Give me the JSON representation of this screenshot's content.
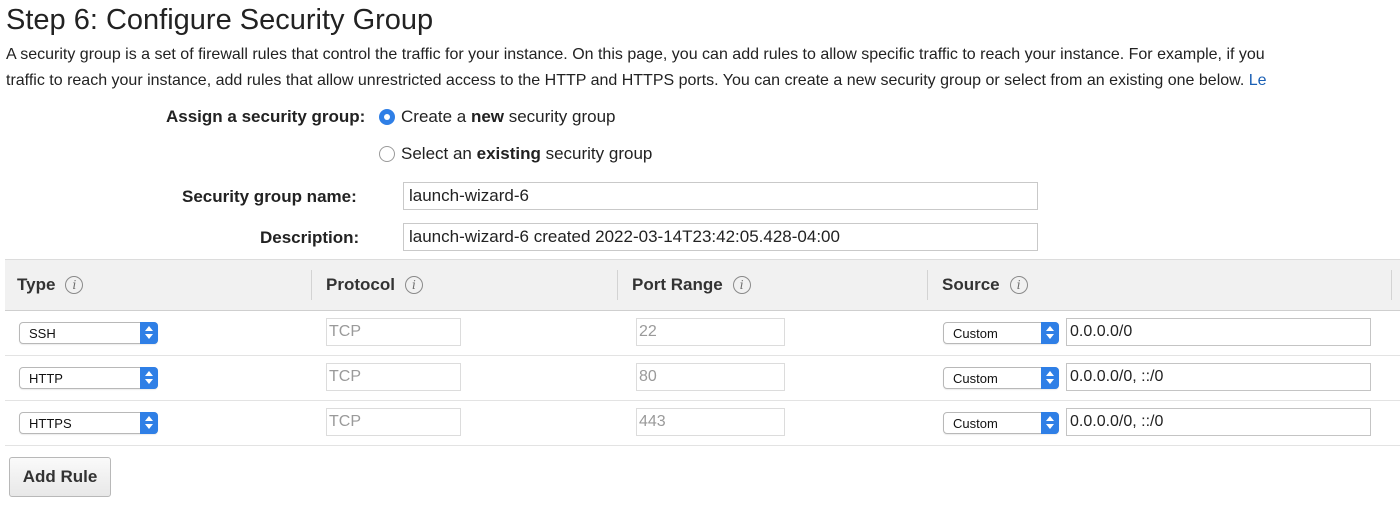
{
  "page": {
    "title": "Step 6: Configure Security Group",
    "description_line1": "A security group is a set of firewall rules that control the traffic for your instance. On this page, you can add rules to allow specific traffic to reach your instance. For example, if you",
    "description_line2": "traffic to reach your instance, add rules that allow unrestricted access to the HTTP and HTTPS ports. You can create a new security group or select from an existing one below.",
    "description_link": "Le"
  },
  "assign": {
    "label": "Assign a security group:",
    "option_new_prefix": "Create a ",
    "option_new_bold": "new",
    "option_new_suffix": " security group",
    "option_existing_prefix": "Select an ",
    "option_existing_bold": "existing",
    "option_existing_suffix": " security group",
    "selected": "new"
  },
  "form": {
    "name_label": "Security group name:",
    "name_value": "launch-wizard-6",
    "description_label": "Description:",
    "description_value": "launch-wizard-6 created 2022-03-14T23:42:05.428-04:00"
  },
  "table": {
    "headers": {
      "type": "Type",
      "protocol": "Protocol",
      "port_range": "Port Range",
      "source": "Source"
    },
    "info_glyph": "i",
    "rows": [
      {
        "type": "SSH",
        "protocol": "TCP",
        "port": "22",
        "source_mode": "Custom",
        "source": "0.0.0.0/0"
      },
      {
        "type": "HTTP",
        "protocol": "TCP",
        "port": "80",
        "source_mode": "Custom",
        "source": "0.0.0.0/0, ::/0"
      },
      {
        "type": "HTTPS",
        "protocol": "TCP",
        "port": "443",
        "source_mode": "Custom",
        "source": "0.0.0.0/0, ::/0"
      }
    ]
  },
  "actions": {
    "add_rule": "Add Rule"
  },
  "colors": {
    "accent": "#2f7fe6",
    "link": "#1a5fb4",
    "header_bg": "#f1f1f1"
  }
}
